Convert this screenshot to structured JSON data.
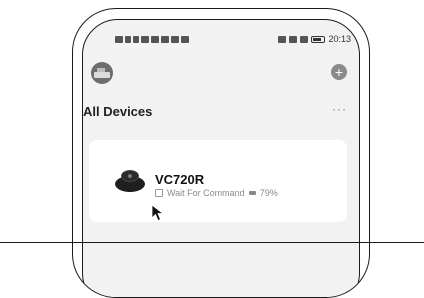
{
  "status_bar": {
    "time": "20:13"
  },
  "header": {
    "add_icon": "plus-circle-icon",
    "title": "All Devices",
    "more": "···"
  },
  "devices": [
    {
      "name": "VC720R",
      "status": "Wait For Command",
      "battery": "79%"
    }
  ]
}
